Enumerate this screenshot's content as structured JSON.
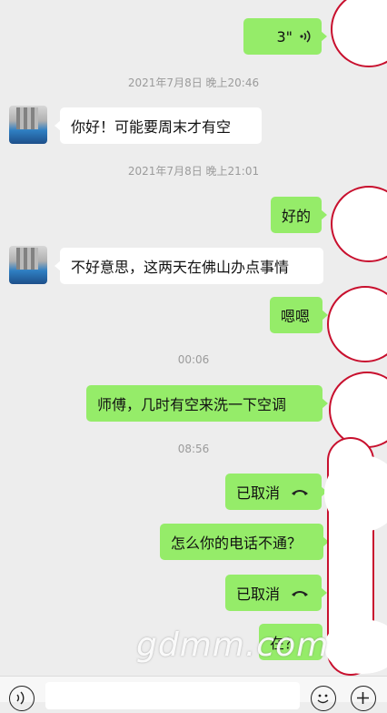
{
  "messages": {
    "voice": {
      "duration": "3\""
    },
    "ts1": "2021年7月8日 晚上20:46",
    "m1": "你好！可能要周末才有空",
    "ts2": "2021年7月8日 晚上21:01",
    "m2": "好的",
    "m3": "不好意思，这两天在佛山办点事情",
    "m4": "嗯嗯",
    "ts3": "00:06",
    "m5": "师傅，几时有空来洗一下空调",
    "ts4": "08:56",
    "m6": "已取消",
    "m7": "怎么你的电话不通？",
    "m8": "已取消",
    "m9": "在？"
  },
  "watermark": "gdmm.com",
  "colors": {
    "sent_bubble": "#95ec69",
    "recv_bubble": "#ffffff",
    "background": "#ededed",
    "annotation": "#c8102e"
  },
  "icons": [
    "voice-wave-icon",
    "phone-hangup-icon",
    "voice-input-icon",
    "emoji-icon",
    "plus-icon"
  ]
}
